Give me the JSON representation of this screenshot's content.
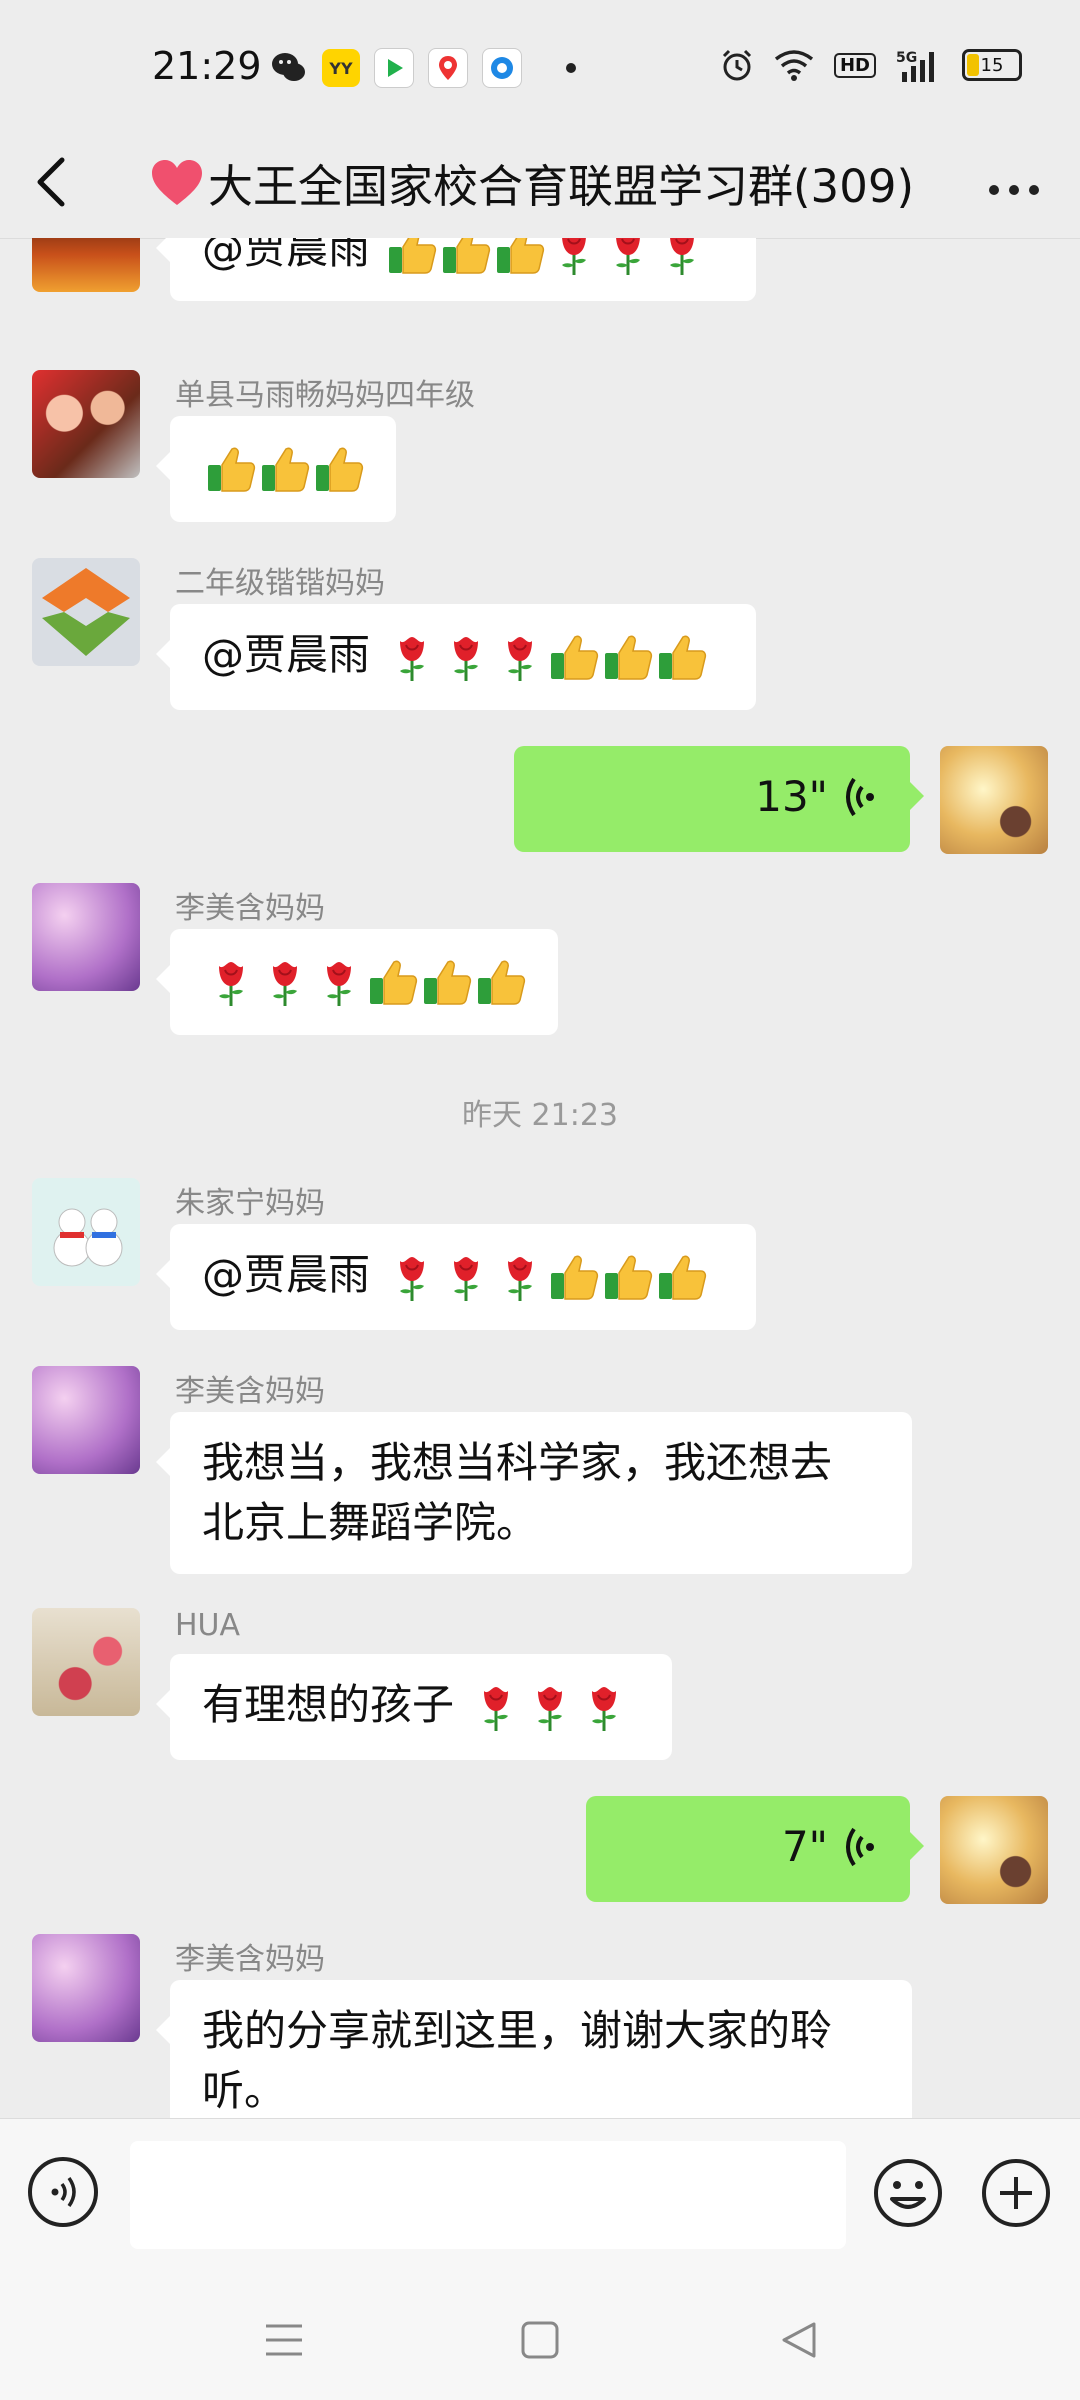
{
  "status_bar": {
    "time": "21:29",
    "battery": "15"
  },
  "header": {
    "title": "大王全国家校合育联盟学习群(309)"
  },
  "messages": [
    {
      "type": "text",
      "text": "@贾晨雨",
      "emojis": [
        "thumb",
        "thumb",
        "thumb",
        "rose",
        "rose",
        "rose"
      ]
    },
    {
      "type": "text",
      "sender": "单县马雨畅妈妈四年级",
      "text": "",
      "emojis": [
        "thumb",
        "thumb",
        "thumb"
      ]
    },
    {
      "type": "text",
      "sender": "二年级锴锴妈妈",
      "text": "@贾晨雨",
      "emojis": [
        "rose",
        "rose",
        "rose",
        "thumb",
        "thumb",
        "thumb"
      ]
    },
    {
      "type": "voice",
      "duration": "13\""
    },
    {
      "type": "text",
      "sender": "李美含妈妈",
      "text": "",
      "emojis": [
        "rose",
        "rose",
        "rose",
        "thumb",
        "thumb",
        "thumb"
      ]
    },
    {
      "type": "time",
      "text": "昨天 21:23"
    },
    {
      "type": "text",
      "sender": "朱家宁妈妈",
      "text": "@贾晨雨",
      "emojis": [
        "rose",
        "rose",
        "rose",
        "thumb",
        "thumb",
        "thumb"
      ]
    },
    {
      "type": "text",
      "sender": "李美含妈妈",
      "lines": [
        "我想当，我想当科学家，我还想去",
        "北京上舞蹈学院。"
      ]
    },
    {
      "type": "text",
      "sender": "HUA",
      "text": "有理想的孩子",
      "emojis": [
        "rose",
        "rose",
        "rose"
      ]
    },
    {
      "type": "voice",
      "duration": "7\""
    },
    {
      "type": "text",
      "sender": "李美含妈妈",
      "lines": [
        "我的分享就到这里，谢谢大家的聆",
        "听。"
      ]
    }
  ],
  "colors": {
    "self_bubble": "#95ec69",
    "bubble": "#ffffff",
    "background": "#ededed"
  },
  "icons": [
    "back-arrow-icon",
    "more-icon",
    "voice-input-icon",
    "emoji-icon",
    "plus-icon",
    "menu-icon",
    "home-icon",
    "back-nav-icon"
  ]
}
